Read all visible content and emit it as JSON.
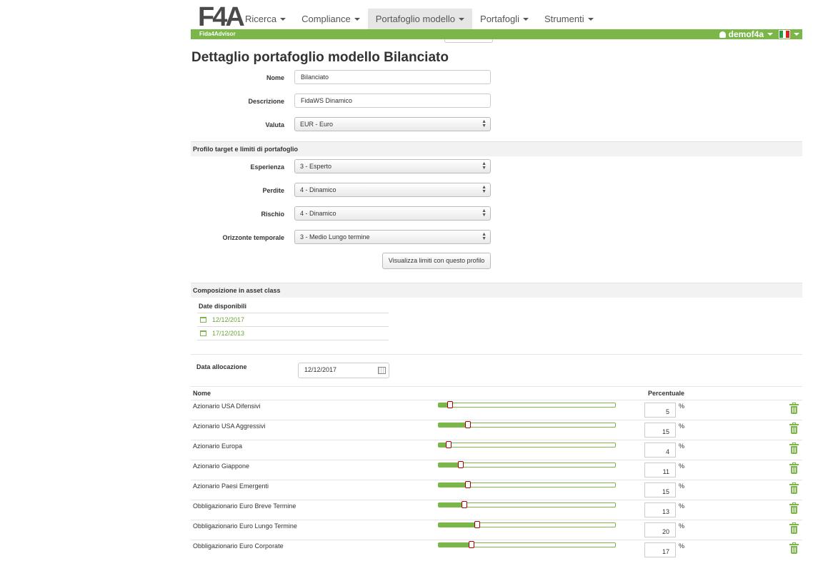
{
  "nav": {
    "brand": "F4A",
    "brand_sub": "Fida4Advisor",
    "items": [
      {
        "label": "Ricerca",
        "active": false
      },
      {
        "label": "Compliance",
        "active": false
      },
      {
        "label": "Portafoglio modello",
        "active": true
      },
      {
        "label": "Portafogli",
        "active": false
      },
      {
        "label": "Strumenti",
        "active": false
      }
    ],
    "user": "demof4a",
    "accent": "#7ab648"
  },
  "page": {
    "title": "Dettaglio portafoglio modello Bilanciato"
  },
  "form": {
    "nome_label": "Nome",
    "nome_value": "Bilanciato",
    "descrizione_label": "Descrizione",
    "descrizione_value": "FidaWS Dinamico",
    "valuta_label": "Valuta",
    "valuta_value": "EUR - Euro"
  },
  "profilo": {
    "section_title": "Profilo target e limiti di portafoglio",
    "esperienza_label": "Esperienza",
    "esperienza_value": "3 - Esperto",
    "perdite_label": "Perdite",
    "perdite_value": "4 - Dinamico",
    "rischio_label": "Rischio",
    "rischio_value": "4 - Dinamico",
    "orizzonte_label": "Orizzonte temporale",
    "orizzonte_value": "3 - Medio Lungo termine",
    "button_label": "Visualizza limiti con questo profilo"
  },
  "composizione": {
    "section_title": "Composizione in asset class",
    "dates_header": "Date disponibili",
    "dates": [
      "12/12/2017",
      "17/12/2013"
    ],
    "alloc_label": "Data allocazione",
    "alloc_value": "12/12/2017",
    "col_nome": "Nome",
    "col_percentuale": "Percentuale",
    "pct_symbol": "%",
    "rows": [
      {
        "name": "Azionario USA Difensivi",
        "value": 5
      },
      {
        "name": "Azionario USA Aggressivi",
        "value": 15
      },
      {
        "name": "Azionario Europa",
        "value": 4
      },
      {
        "name": "Azionario Giappone",
        "value": 11
      },
      {
        "name": "Azionario Paesi Emergenti",
        "value": 15
      },
      {
        "name": "Obbligazionario Euro Breve Termine",
        "value": 13
      },
      {
        "name": "Obbligazionario Euro Lungo Termine",
        "value": 20
      },
      {
        "name": "Obbligazionario Euro Corporate",
        "value": 17
      }
    ]
  }
}
